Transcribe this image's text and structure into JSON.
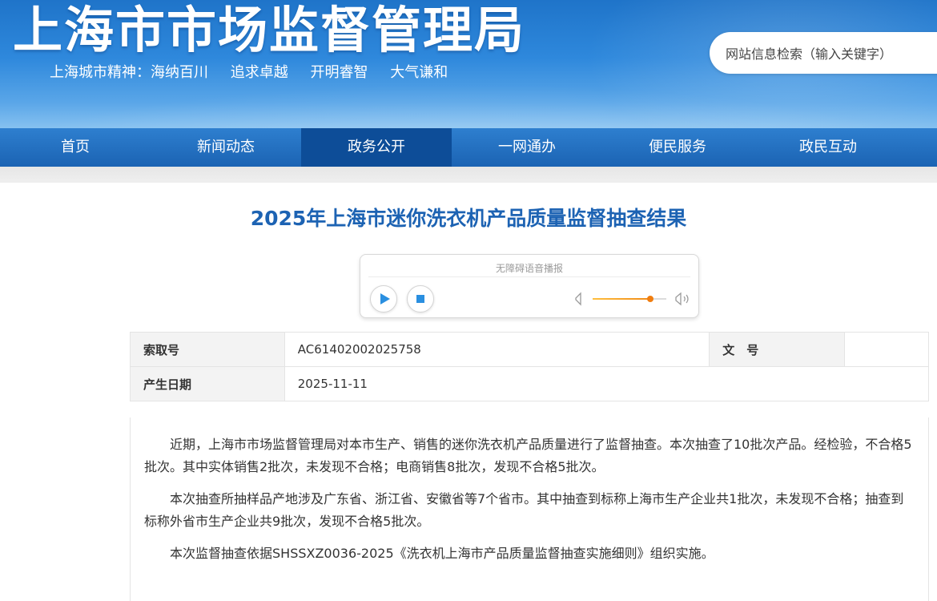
{
  "header": {
    "site_title": "上海市市场监督管理局",
    "slogan": [
      "上海城市精神：海纳百川",
      "追求卓越",
      "开明睿智",
      "大气谦和"
    ],
    "search_placeholder": "网站信息检索（输入关键字）"
  },
  "nav": {
    "items": [
      {
        "label": "首页",
        "active": false
      },
      {
        "label": "新闻动态",
        "active": false
      },
      {
        "label": "政务公开",
        "active": true
      },
      {
        "label": "一网通办",
        "active": false
      },
      {
        "label": "便民服务",
        "active": false
      },
      {
        "label": "政民互动",
        "active": false
      }
    ]
  },
  "article": {
    "title": "2025年上海市迷你洗衣机产品质量监督抽查结果",
    "player": {
      "status": "无障碍语音播报",
      "volume_fraction": 0.78,
      "accent_color": "#f08a16",
      "button_color": "#2a8fe0"
    },
    "meta": {
      "index_label": "索取号",
      "index_value": "AC61402002025758",
      "doc_label": "文　号",
      "doc_value": "",
      "date_label": "产生日期",
      "date_value": "2025-11-11"
    },
    "paragraphs": [
      "近期，上海市市场监督管理局对本市生产、销售的迷你洗衣机产品质量进行了监督抽查。本次抽查了10批次产品。经检验，不合格5批次。其中实体销售2批次，未发现不合格；电商销售8批次，发现不合格5批次。",
      "本次抽查所抽样品产地涉及广东省、浙江省、安徽省等7个省市。其中抽查到标称上海市生产企业共1批次，未发现不合格；抽查到标称外省市生产企业共9批次，发现不合格5批次。",
      "本次监督抽查依据SHSSXZ0036-2025《洗衣机上海市产品质量监督抽查实施细则》组织实施。"
    ]
  },
  "colors": {
    "header_blue": "#1f74c9",
    "nav_active": "#0d4d98",
    "title_blue": "#1d63b3"
  }
}
